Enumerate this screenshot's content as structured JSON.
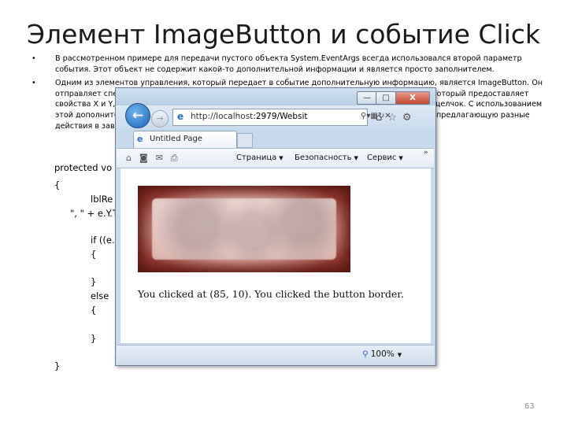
{
  "slide": {
    "title": "Элемент ImageButton и событие Click",
    "bullets": [
      "В рассмотренном примере для передачи пустого объекта System.EventArgs всегда использовался второй параметр события. Этот объект не содержит какой-то дополнительной информации и является просто заполнителем.",
      "Одним из элементов управления, который передает в событие дополнительную информацию, является ImageButton. Он отправляет специальный объект ImageClickEventArgs (из пространства имен System.Web.UI), который предоставляет свойства X и Y, представляющие местоположение, в котором на изображении был выполнен щелчок. С использованием этой дополнительной информации можно создать базовую графическую карту изображения, предлагающую разные действия в зависимости от местоположения, в котором был совершен щелчок, и проверять..."
    ],
    "bullet_char": "•",
    "code_lines": [
      "protected vo",
      "{",
      "lblRe",
      "\", \" + e.Y.T",
      "if ((e.",
      "{",
      "}",
      "else",
      "{",
      "}",
      "}"
    ],
    "page_number": "63"
  },
  "browser": {
    "address_url_prefix": "http://localhost",
    "address_url_rest": ":2979/Websit",
    "tab_title": "Untitled Page",
    "menu": {
      "page": "Страница",
      "security": "Безопасность",
      "service": "Сервис"
    },
    "more": "»",
    "result_text": "You clicked at (85, 10). You clicked the button border.",
    "zoom": "100%",
    "window_buttons": {
      "minimize": "—",
      "maximize": "□",
      "close": "X"
    },
    "back_glyph": "←",
    "forward_glyph": "→"
  }
}
